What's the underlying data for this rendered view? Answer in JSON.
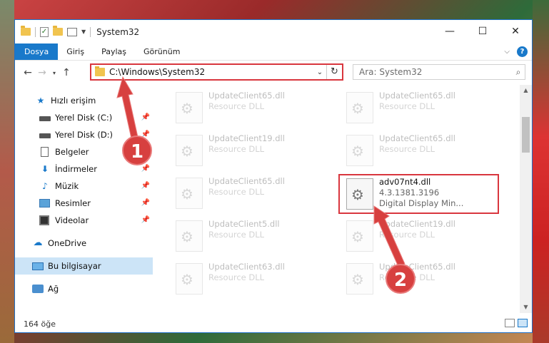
{
  "window": {
    "title": "System32",
    "controls": {
      "minimize": "—",
      "maximize": "☐",
      "close": "✕"
    }
  },
  "ribbon": {
    "tabs": [
      {
        "label": "Dosya",
        "active": true
      },
      {
        "label": "Giriş"
      },
      {
        "label": "Paylaş"
      },
      {
        "label": "Görünüm"
      }
    ],
    "help": "?"
  },
  "address": {
    "path": "C:\\Windows\\System32",
    "search_placeholder": "Ara: System32"
  },
  "sidebar": {
    "items": [
      {
        "label": "Hızlı erişim",
        "icon": "star-icon",
        "pinned": false
      },
      {
        "label": "Yerel Disk (C:)",
        "icon": "drive-icon",
        "pinned": true
      },
      {
        "label": "Yerel Disk (D:)",
        "icon": "drive-icon",
        "pinned": true
      },
      {
        "label": "Belgeler",
        "icon": "document-icon",
        "pinned": true
      },
      {
        "label": "İndirmeler",
        "icon": "download-icon",
        "pinned": true
      },
      {
        "label": "Müzik",
        "icon": "music-icon",
        "pinned": true
      },
      {
        "label": "Resimler",
        "icon": "pictures-icon",
        "pinned": true
      },
      {
        "label": "Videolar",
        "icon": "videos-icon",
        "pinned": true
      },
      {
        "label": "OneDrive",
        "icon": "cloud-icon"
      },
      {
        "label": "Bu bilgisayar",
        "icon": "computer-icon",
        "selected": true
      },
      {
        "label": "Ağ",
        "icon": "network-icon"
      }
    ]
  },
  "files": [
    {
      "name": "UpdateClient65.dll",
      "type": "Resource DLL",
      "faded": true
    },
    {
      "name": "UpdateClient65.dll",
      "type": "Resource DLL",
      "faded": true
    },
    {
      "name": "UpdateClient19.dll",
      "type": "Resource DLL",
      "faded": true
    },
    {
      "name": "UpdateClient65.dll",
      "type": "Resource DLL",
      "faded": true
    },
    {
      "name": "UpdateClient65.dll",
      "type": "Resource DLL",
      "faded": true
    },
    {
      "name": "adv07nt4.dll",
      "version": "4.3.1381.3196",
      "type": "Digital Display Min...",
      "faded": false
    },
    {
      "name": "UpdateClient5.dll",
      "type": "Resource DLL",
      "faded": true
    },
    {
      "name": "UpdateClient19.dll",
      "type": "Resource DLL",
      "faded": true
    },
    {
      "name": "UpdateClient63.dll",
      "type": "Resource DLL",
      "faded": true
    },
    {
      "name": "UpdateClient65.dll",
      "type": "Resource DLL",
      "faded": true
    }
  ],
  "status": {
    "count": "164 öğe"
  },
  "annotations": {
    "step1": "1",
    "step2": "2",
    "color": "#d7403f"
  }
}
